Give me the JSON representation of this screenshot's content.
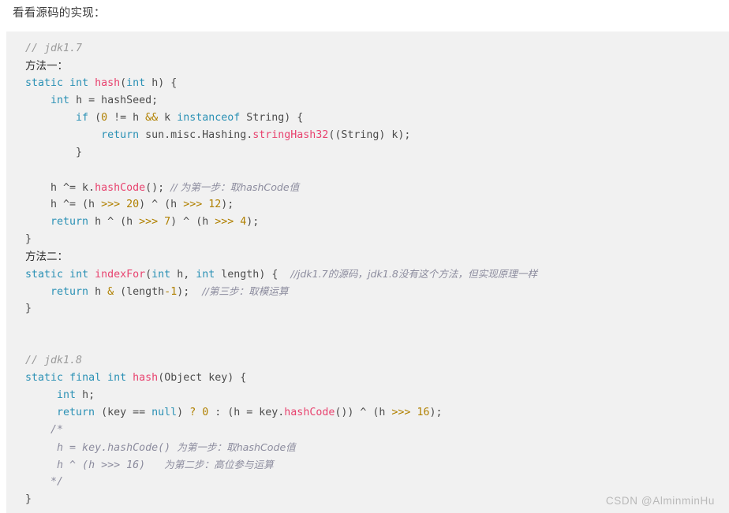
{
  "intro": {
    "text": "看看源码的实现："
  },
  "code": {
    "language": "java",
    "background_color": "#f1f1f1",
    "token_colors": {
      "keyword": "#2b91b5",
      "function": "#e8436f",
      "number": "#b08000",
      "operator": "#b08000",
      "comment": "#8c8c9e",
      "plain": "#4c4c4c"
    },
    "lines": {
      "l1_comment": "// jdk1.7",
      "l2_label": "方法一：",
      "l3": {
        "kw_static": "static",
        "kw_int": "int",
        "fn_hash": "hash",
        "paren_open": "(",
        "kw_int2": "int",
        "arg_h": " h",
        "paren_close": ") {"
      },
      "l4": {
        "kw_int": "int",
        "rest": " h = hashSeed;"
      },
      "l5": {
        "kw_if": "if",
        "open": " (",
        "num_zero": "0",
        "neq": " != h ",
        "op_and": "&&",
        "k": " k ",
        "kw_instanceof": "instanceof",
        "tail": " String) {"
      },
      "l6": {
        "kw_return": "return",
        "mid": " sun.misc.Hashing.",
        "fn_call": "stringHash32",
        "tail": "((String) k);"
      },
      "l7": "        }",
      "l8_blank": "",
      "l9": {
        "lead": "    h ^= k.",
        "fn_call": "hashCode",
        "tail": "(); ",
        "comment": "// 为第一步：取hashCode值"
      },
      "l10": {
        "lead": "    h ^= (h ",
        "op1": ">>>",
        "num1": " 20",
        "mid": ") ^ (h ",
        "op2": ">>>",
        "num2": " 12",
        "tail": ");"
      },
      "l11": {
        "kw_return": "return",
        "mid1": " h ^ (h ",
        "op1": ">>>",
        "num1": " 7",
        "mid2": ") ^ (h ",
        "op2": ">>>",
        "num2": " 4",
        "tail": ");"
      },
      "l12": "}",
      "l13_label": "方法二：",
      "l14": {
        "kw_static": "static",
        "kw_int": "int",
        "fn_indexfor": "indexFor",
        "paren": "(",
        "kw_int2": "int",
        "arg_h": " h, ",
        "kw_int3": "int",
        "arg_len": " length",
        "tail": ") {  ",
        "comment": "//jdk1.7的源码，jdk1.8没有这个方法，但实现原理一样"
      },
      "l15": {
        "kw_return": "return",
        "mid": " h ",
        "op_amp": "&",
        "mid2": " (length",
        "minus": "-",
        "num_one": "1",
        "tail": ");  ",
        "comment": "//第三步：取模运算"
      },
      "l16": "}",
      "l17_blank": "",
      "l18_blank": "",
      "l19_comment": "// jdk1.8",
      "l20": {
        "kw_static": "static",
        "kw_final": "final",
        "kw_int": "int",
        "fn_hash": "hash",
        "tail": "(Object key) {"
      },
      "l21": {
        "kw_int": "int",
        "tail": " h;"
      },
      "l22": {
        "kw_return": "return",
        "mid1": " (key == ",
        "kw_null": "null",
        "mid2": ") ",
        "op_q": "?",
        "num_zero": " 0",
        "mid3": " : (h = key.",
        "fn_call": "hashCode",
        "mid4": "()) ^ (h ",
        "op_shift": ">>>",
        "num16": " 16",
        "tail": ");"
      },
      "l23_comment": "/*",
      "l24_comment": " h = key.hashCode() ",
      "l24_cn": "为第一步：取hashCode值",
      "l25_comment": " h ^ (h >>> 16)   ",
      "l25_cn": "为第二步：高位参与运算",
      "l26_comment": "*/",
      "l27": "}"
    }
  },
  "watermark": {
    "text": "CSDN @AlminminHu"
  }
}
